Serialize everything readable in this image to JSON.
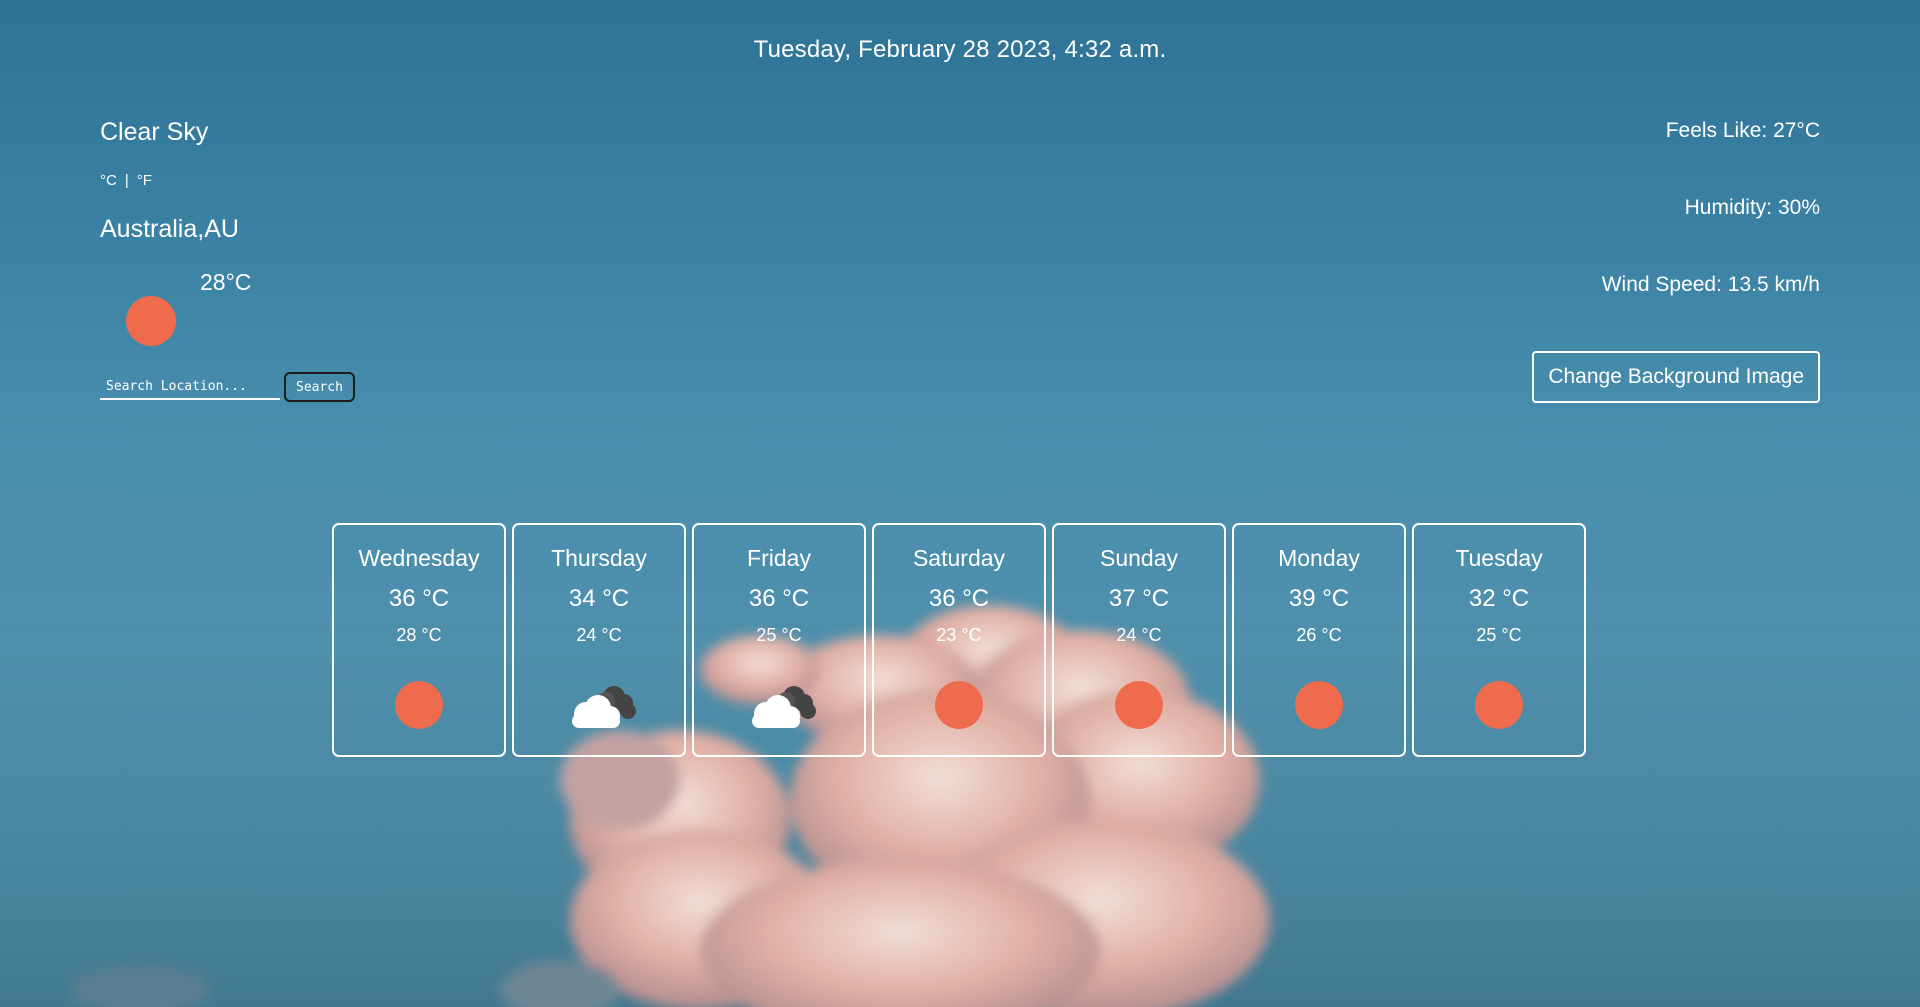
{
  "datetime": "Tuesday, February 28 2023, 4:32 a.m.",
  "current": {
    "condition": "Clear Sky",
    "unit_celsius": "°C",
    "unit_separator": "|",
    "unit_fahrenheit": "°F",
    "location": "Australia,AU",
    "temperature": "28°C",
    "icon": "sun-icon"
  },
  "search": {
    "placeholder": "Search Location...",
    "button_label": "Search"
  },
  "stats": {
    "feels_like": "Feels Like: 27°C",
    "humidity": "Humidity: 30%",
    "wind_speed": "Wind Speed: 13.5 km/h"
  },
  "change_background_label": "Change Background Image",
  "forecast": [
    {
      "day": "Wednesday",
      "high": "36 °C",
      "low": "28 °C",
      "icon": "sun-icon"
    },
    {
      "day": "Thursday",
      "high": "34 °C",
      "low": "24 °C",
      "icon": "partly-cloudy-icon"
    },
    {
      "day": "Friday",
      "high": "36 °C",
      "low": "25 °C",
      "icon": "partly-cloudy-icon"
    },
    {
      "day": "Saturday",
      "high": "36 °C",
      "low": "23 °C",
      "icon": "sun-icon"
    },
    {
      "day": "Sunday",
      "high": "37 °C",
      "low": "24 °C",
      "icon": "sun-icon"
    },
    {
      "day": "Monday",
      "high": "39 °C",
      "low": "26 °C",
      "icon": "sun-icon"
    },
    {
      "day": "Tuesday",
      "high": "32 °C",
      "low": "25 °C",
      "icon": "sun-icon"
    }
  ],
  "colors": {
    "sun": "#ee6c4d",
    "sky_top": "#2e7396",
    "sky_bottom": "#41788f",
    "cloud_light": "#ffffff",
    "cloud_dark": "#444444",
    "cloud_pink": "#f2c4b8"
  }
}
